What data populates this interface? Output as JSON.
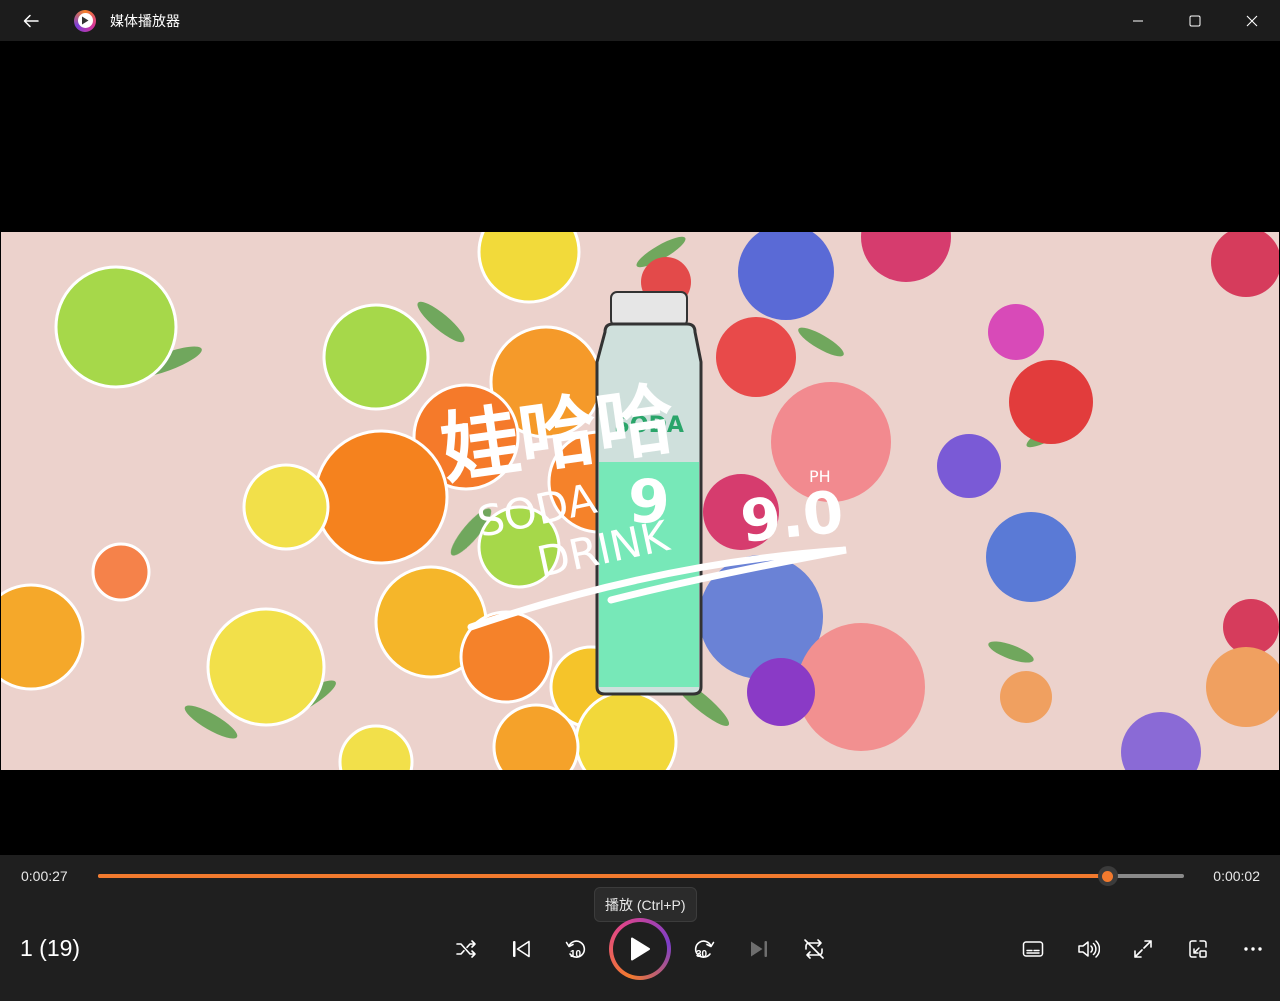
{
  "window": {
    "title": "媒体播放器",
    "icons": {
      "back": "back-arrow-icon",
      "app": "media-player-logo-icon",
      "minimize": "minimize-icon",
      "maximize": "maximize-icon",
      "close": "close-icon"
    }
  },
  "video": {
    "overlay_text": [
      "娃哈哈",
      "SODA",
      "DRINK",
      "9.0",
      "PH"
    ]
  },
  "playback": {
    "elapsed": "0:00:27",
    "remaining": "0:00:02",
    "progress": 0.93,
    "track_info": "1 (19)",
    "tooltip": "播放 (Ctrl+P)",
    "skip_back_seconds": "10",
    "skip_forward_seconds": "30",
    "accent_color": "#f27a2e"
  },
  "controls": {
    "icons": [
      "shuffle-icon",
      "previous-icon",
      "skip-back-10-icon",
      "play-icon",
      "skip-forward-30-icon",
      "next-icon",
      "repeat-off-icon",
      "subtitles-icon",
      "volume-icon",
      "fullscreen-icon",
      "mini-player-icon",
      "more-options-icon"
    ]
  }
}
